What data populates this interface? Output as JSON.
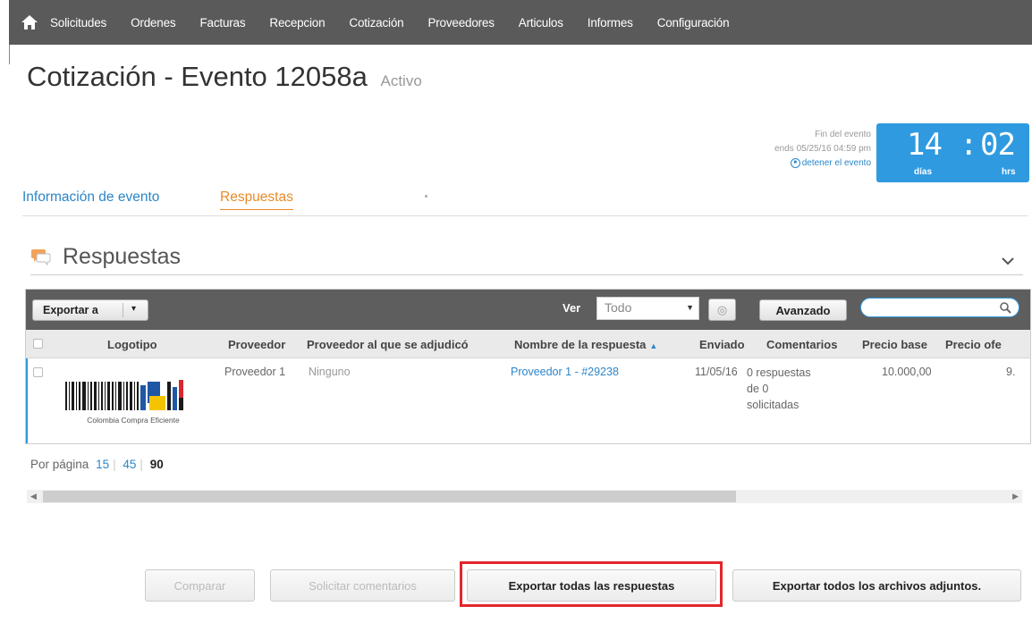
{
  "nav": {
    "items": [
      "Solicitudes",
      "Ordenes",
      "Facturas",
      "Recepcion",
      "Cotización",
      "Proveedores",
      "Articulos",
      "Informes",
      "Configuración"
    ]
  },
  "page": {
    "title": "Cotización  - Evento 12058a",
    "status": "Activo"
  },
  "event": {
    "end_label": "Fin del evento",
    "ends_text": "ends 05/25/16 04:59 pm",
    "stop_label": "detener el evento"
  },
  "timer": {
    "days": "14",
    "separator": ":",
    "hours": "02",
    "days_label": "días",
    "hours_label": "hrs"
  },
  "tabs": {
    "info": "Información de evento",
    "responses": "Respuestas"
  },
  "section": {
    "title": "Respuestas"
  },
  "toolbar": {
    "export_label": "Exportar a",
    "view_label": "Ver",
    "view_value": "Todo",
    "advanced_label": "Avanzado"
  },
  "table": {
    "headers": [
      "Logotipo",
      "Proveedor",
      "Proveedor al que se adjudicó",
      "Nombre de la respuesta",
      "Enviado",
      "Comentarios",
      "Precio base",
      "Precio ofe"
    ],
    "rows": [
      {
        "logo_text": "Colombia Compra Eficiente",
        "proveedor": "Proveedor 1",
        "adjudicado": "Ninguno",
        "nombre": "Proveedor 1 - #29238",
        "enviado": "11/05/16",
        "comentarios": "0 respuestas de 0 solicitadas",
        "precio_base": "10.000,00",
        "precio_ofe": "9."
      }
    ]
  },
  "pagination": {
    "label": "Por página",
    "options": [
      "15",
      "45",
      "90"
    ]
  },
  "buttons": {
    "compare": "Comparar",
    "request_comments": "Solicitar comentarios",
    "export_responses": "Exportar todas las respuestas",
    "export_attachments": "Exportar todos los archivos adjuntos."
  },
  "colors": {
    "nav_bg": "#5a5a5a",
    "accent_blue": "#2f9ae0",
    "accent_orange": "#e98a27",
    "highlight_red": "#e3262d"
  }
}
